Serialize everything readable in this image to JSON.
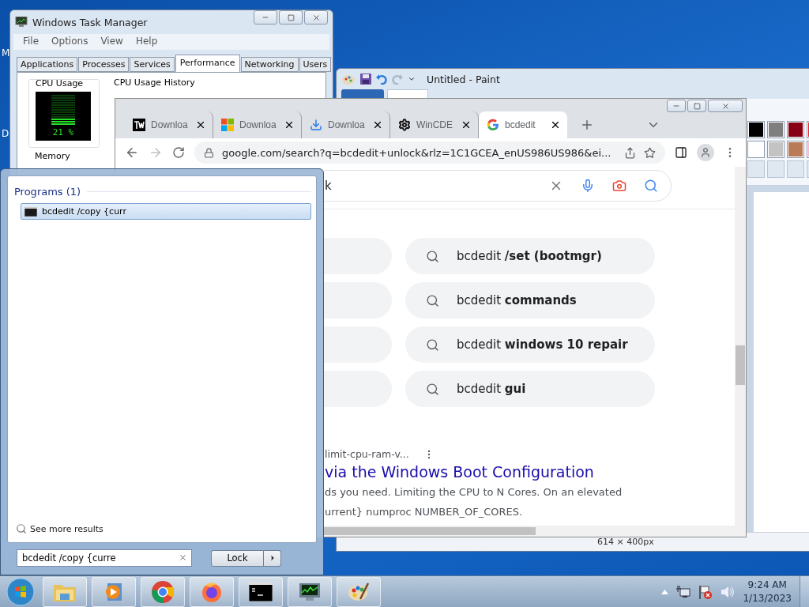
{
  "desktop": {
    "icon_labels": [
      "M",
      "D"
    ]
  },
  "task_manager": {
    "title": "Windows Task Manager",
    "menu": [
      "File",
      "Options",
      "View",
      "Help"
    ],
    "tabs": [
      {
        "label": "Applications",
        "selected": false
      },
      {
        "label": "Processes",
        "selected": false
      },
      {
        "label": "Services",
        "selected": false
      },
      {
        "label": "Performance",
        "selected": true
      },
      {
        "label": "Networking",
        "selected": false
      },
      {
        "label": "Users",
        "selected": false
      }
    ],
    "cpu": {
      "label": "CPU Usage",
      "reading": "21 %",
      "level": 0.21
    },
    "history_label": "CPU Usage History",
    "memory_label": "Memory"
  },
  "paint": {
    "title": "Untitled - Paint",
    "palette": [
      {
        "color": "#000000"
      },
      {
        "color": "#7f7f7f"
      },
      {
        "color": "#880015"
      },
      {
        "color": "#ed1c24"
      },
      {
        "color": "#ffffff"
      },
      {
        "color": "#c3c3c3"
      },
      {
        "color": "#b97a57"
      },
      {
        "color": "#ffaec9"
      }
    ],
    "status": "614 × 400px"
  },
  "browser": {
    "tabs": [
      {
        "kind": "tw",
        "title": "Downloa",
        "selected": false
      },
      {
        "kind": "windows",
        "title": "Downloa",
        "selected": false
      },
      {
        "kind": "download",
        "title": "Downloa",
        "selected": false
      },
      {
        "kind": "gear",
        "title": "WinCDE",
        "selected": false
      },
      {
        "kind": "google",
        "title": "bcdedit",
        "selected": true
      }
    ],
    "url": "google.com/search?q=bcdedit+unlock&rlz=1C1GCEA_enUS986US986&ei...",
    "search_value": "k",
    "suggestions": [
      "bcdedit **/set (bootmgr)**",
      "bcdedit **commands**",
      "bcdedit **windows 10 repair**",
      "bcdedit **gui**"
    ],
    "result": {
      "url": "limit-cpu-ram-v...",
      "title": "via the Windows Boot Configuration",
      "snippet": [
        "ds you need. Limiting the CPU to N Cores. On an elevated",
        "urrent} numproc NUMBER_OF_CORES."
      ]
    }
  },
  "start_menu": {
    "section": "Programs (1)",
    "results": [
      {
        "label": "bcdedit /copy {curr",
        "selected": true
      }
    ],
    "more": "See more results",
    "search_value": "bcdedit /copy {curre",
    "power_button": "Lock"
  },
  "taskbar": {
    "apps": [
      {
        "kind": "explorer"
      },
      {
        "kind": "media"
      },
      {
        "kind": "chrome"
      },
      {
        "kind": "firefox"
      },
      {
        "kind": "cmd"
      },
      {
        "kind": "taskmgr"
      },
      {
        "kind": "paint"
      }
    ],
    "clock": {
      "time": "9:24 AM",
      "date": "1/13/2023"
    }
  }
}
